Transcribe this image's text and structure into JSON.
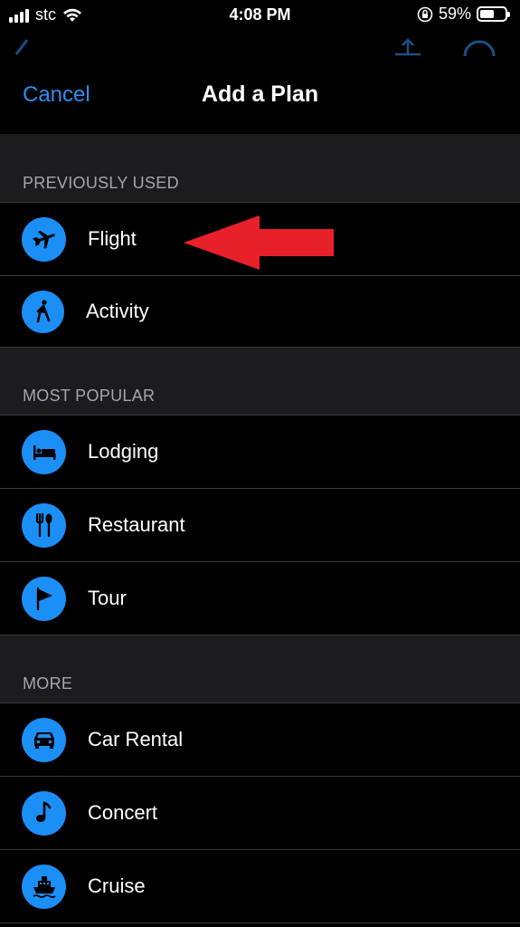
{
  "status_bar": {
    "carrier": "stc",
    "time": "4:08 PM",
    "battery_percent": "59%",
    "battery_level": 0.59
  },
  "nav": {
    "cancel_label": "Cancel",
    "title": "Add a Plan"
  },
  "sections": [
    {
      "header": "PREVIOUSLY USED",
      "items": [
        {
          "label": "Flight",
          "icon": "airplane-icon"
        },
        {
          "label": "Activity",
          "icon": "walking-person-icon"
        }
      ]
    },
    {
      "header": "MOST POPULAR",
      "items": [
        {
          "label": "Lodging",
          "icon": "bed-icon"
        },
        {
          "label": "Restaurant",
          "icon": "fork-spoon-icon"
        },
        {
          "label": "Tour",
          "icon": "flag-icon"
        }
      ]
    },
    {
      "header": "MORE",
      "items": [
        {
          "label": "Car Rental",
          "icon": "car-icon"
        },
        {
          "label": "Concert",
          "icon": "music-note-icon"
        },
        {
          "label": "Cruise",
          "icon": "ship-icon"
        }
      ]
    }
  ],
  "colors": {
    "accent": "#1b8ff6",
    "link": "#2e8ef0",
    "section_bg": "#1c1c1e",
    "annotation_arrow": "#e8202a"
  }
}
